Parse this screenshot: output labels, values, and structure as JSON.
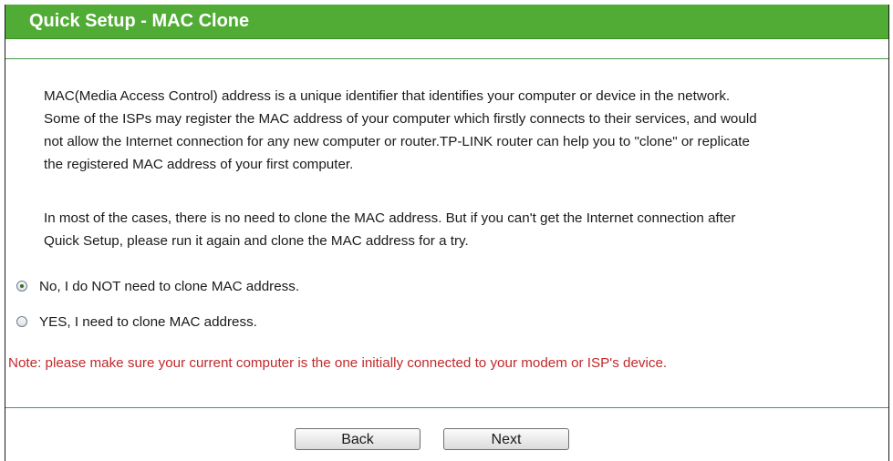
{
  "header": {
    "title": "Quick Setup - MAC Clone"
  },
  "description": {
    "paragraph1_lines": [
      "MAC(Media Access Control) address is a unique identifier that identifies your computer or device in the network.",
      "Some of the ISPs may register the MAC address of your computer which firstly connects to their services, and would",
      "not allow the Internet connection for any new computer or router.TP-LINK router can help you to \"clone\" or replicate",
      "the registered MAC address of your first computer."
    ],
    "paragraph2_lines": [
      "In most of the cases, there is no need to clone the MAC address. But if you can't get the Internet connection after",
      "Quick Setup, please run it again and clone the MAC address for a try."
    ]
  },
  "options": [
    {
      "label": "No, I do NOT need to clone MAC address.",
      "checked": true
    },
    {
      "label": "YES, I need to clone MAC address.",
      "checked": false
    }
  ],
  "note": "Note: please make sure your current computer is the one initially connected to your modem or ISP's device.",
  "buttons": {
    "back": "Back",
    "next": "Next"
  },
  "colors": {
    "header_bg": "#50ac34",
    "note_text": "#c0292b"
  }
}
